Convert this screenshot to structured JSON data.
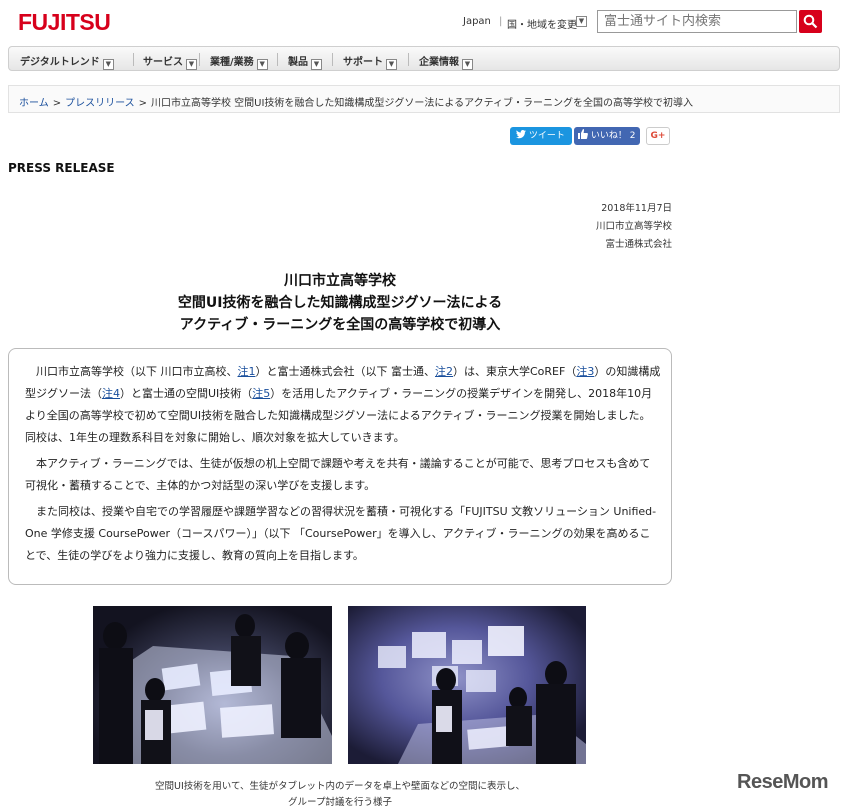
{
  "header": {
    "logo": "FUJITSU",
    "region_japan": "Japan",
    "region_separator": "|",
    "region_change": "国・地域を変更",
    "search_placeholder": "富士通サイト内検索"
  },
  "nav": {
    "items": [
      {
        "label": "デジタルトレンド"
      },
      {
        "label": "サービス"
      },
      {
        "label": "業種/業務"
      },
      {
        "label": "製品"
      },
      {
        "label": "サポート"
      },
      {
        "label": "企業情報"
      }
    ]
  },
  "breadcrumb": {
    "home": "ホーム",
    "press": "プレスリリース",
    "separator": ">",
    "current": "川口市立高等学校 空間UI技術を融合した知識構成型ジグソー法によるアクティブ・ラーニングを全国の高等学校で初導入"
  },
  "social": {
    "tweet": "ツイート",
    "like": "いいね！ 2",
    "gplus": "G+"
  },
  "press_label": "PRESS RELEASE",
  "meta": {
    "date": "2018年11月7日",
    "org1": "川口市立高等学校",
    "org2": "富士通株式会社"
  },
  "title": {
    "line1": "川口市立高等学校",
    "line2": "空間UI技術を融合した知識構成型ジグソー法による",
    "line3": "アクティブ・ラーニングを全国の高等学校で初導入"
  },
  "body": {
    "p1": {
      "t1": "川口市立高等学校（以下 川口市立高校、",
      "n1": "注1",
      "t2": "）と富士通株式会社（以下 富士通、",
      "n2": "注2",
      "t3": "）は、東京大学CoREF（",
      "n3": "注3",
      "t4": "）の知識構成型ジグソー法（",
      "n4": "注4",
      "t5": "）と富士通の空間UI技術（",
      "n5": "注5",
      "t6": "）を活用したアクティブ・ラーニングの授業デザインを開発し、2018年10月より全国の高等学校で初めて空間UI技術を融合した知識構成型ジグソー法によるアクティブ・ラーニング授業を開始しました。同校は、1年生の理数系科目を対象に開始し、順次対象を拡大していきます。"
    },
    "p2": "本アクティブ・ラーニングでは、生徒が仮想の机上空間で課題や考えを共有・議論することが可能で、思考プロセスも含めて可視化・蓄積することで、主体的かつ対話型の深い学びを支援します。",
    "p3": "また同校は、授業や自宅での学習履歴や課題学習などの習得状況を蓄積・可視化する「FUJITSU 文教ソリューション Unified-One 学修支援 CoursePower（コースパワー）」（以下 「CoursePower」を導入し、アクティブ・ラーニングの効果を高めることで、生徒の学びをより強力に支援し、教育の質向上を目指します。"
  },
  "caption": {
    "line1": "空間UI技術を用いて、生徒がタブレット内のデータを卓上や壁面などの空間に表示し、",
    "line2": "グループ討議を行う様子"
  },
  "watermark": "ReseMom"
}
